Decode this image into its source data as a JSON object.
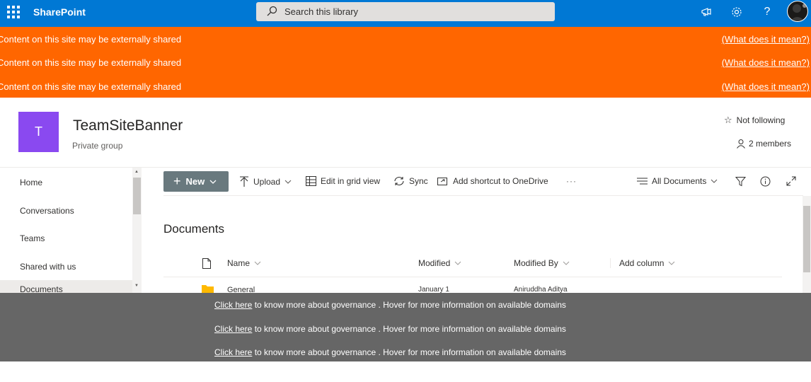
{
  "suite_bar": {
    "brand": "SharePoint",
    "search_placeholder": "Search this library",
    "colors": {
      "background": "#0078d4"
    },
    "icons": [
      "waffle-icon",
      "megaphone-icon",
      "gear-icon",
      "help-icon",
      "avatar"
    ]
  },
  "external_banners": [
    {
      "text": "Content on this site may be externally shared",
      "link": "(What does it mean?)"
    },
    {
      "text": "Content on this site may be externally shared",
      "link": "(What does it mean?)"
    },
    {
      "text": "Content on this site may be externally shared",
      "link": "(What does it mean?)"
    }
  ],
  "banner_color": "#ff6600",
  "site": {
    "logo_letter": "T",
    "logo_color": "#8a49f0",
    "title": "TeamSiteBanner",
    "subtitle": "Private group",
    "follow_label": "Not following",
    "members_label": "2 members"
  },
  "nav": {
    "items": [
      {
        "label": "Home"
      },
      {
        "label": "Conversations"
      },
      {
        "label": "Teams"
      },
      {
        "label": "Shared with us"
      },
      {
        "label": "Documents"
      }
    ]
  },
  "command_bar": {
    "new_label": "New",
    "upload_label": "Upload",
    "grid_label": "Edit in grid view",
    "sync_label": "Sync",
    "shortcut_label": "Add shortcut to OneDrive",
    "more_label": "···",
    "view_label": "All Documents"
  },
  "library": {
    "heading": "Documents",
    "columns": {
      "name": "Name",
      "modified": "Modified",
      "modified_by": "Modified By",
      "add_column": "Add column"
    },
    "rows": [
      {
        "name": "General",
        "modified": "January 1",
        "modified_by": "Aniruddha Aditya"
      }
    ]
  },
  "governance_banners": [
    {
      "link": "Click here",
      "text": " to know more about governance . Hover for more information on available domains"
    },
    {
      "link": "Click here",
      "text": " to know more about governance . Hover for more information on available domains"
    },
    {
      "link": "Click here",
      "text": " to know more about governance . Hover for more information on available domains"
    }
  ],
  "governance_color": "#666666"
}
